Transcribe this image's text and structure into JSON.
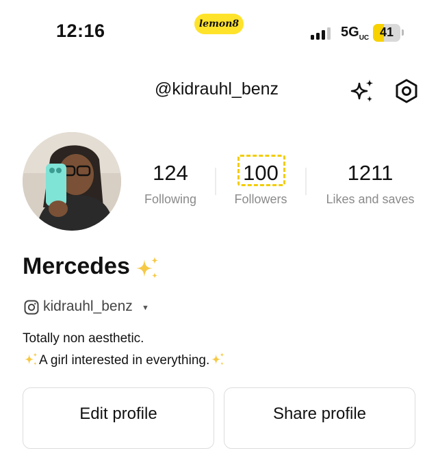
{
  "status_bar": {
    "time": "12:16",
    "app_badge": "lemon8",
    "network": "5G",
    "network_suffix": "UC",
    "battery": "41",
    "battery_level": 0.41,
    "accent": "#ffe32b"
  },
  "header": {
    "username": "@kidrauhl_benz",
    "sparkle_icon": "sparkle-icon",
    "settings_icon": "hexagon-settings-icon"
  },
  "stats": {
    "following": {
      "value": "124",
      "label": "Following"
    },
    "followers": {
      "value": "100",
      "label": "Followers"
    },
    "likes": {
      "value": "1211",
      "label": "Likes and saves"
    }
  },
  "profile": {
    "name": "Mercedes",
    "instagram_handle": "kidrauhl_benz",
    "bio_line1": "Totally non aesthetic.",
    "bio_line2": "A girl interested in everything."
  },
  "actions": {
    "edit": "Edit profile",
    "share": "Share profile"
  }
}
